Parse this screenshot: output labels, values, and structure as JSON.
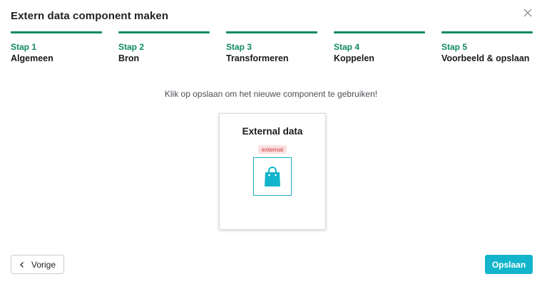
{
  "dialog": {
    "title": "Extern data component maken",
    "close_icon": "close-icon"
  },
  "steps": [
    {
      "number": "Stap 1",
      "label": "Algemeen"
    },
    {
      "number": "Stap 2",
      "label": "Bron"
    },
    {
      "number": "Stap 3",
      "label": "Transformeren"
    },
    {
      "number": "Stap 4",
      "label": "Koppelen"
    },
    {
      "number": "Stap 5",
      "label": "Voorbeeld & opslaan"
    }
  ],
  "hint": "Klik op opslaan om het nieuwe component te gebruiken!",
  "preview": {
    "title": "External data",
    "badge": "external",
    "icon": "shopping-bag-icon"
  },
  "footer": {
    "back_label": "Vorige",
    "save_label": "Opslaan"
  },
  "colors": {
    "step_accent": "#0f8a5f",
    "primary_button": "#12b5cb",
    "badge_bg": "#fbe0e0",
    "badge_text": "#d0343a"
  }
}
